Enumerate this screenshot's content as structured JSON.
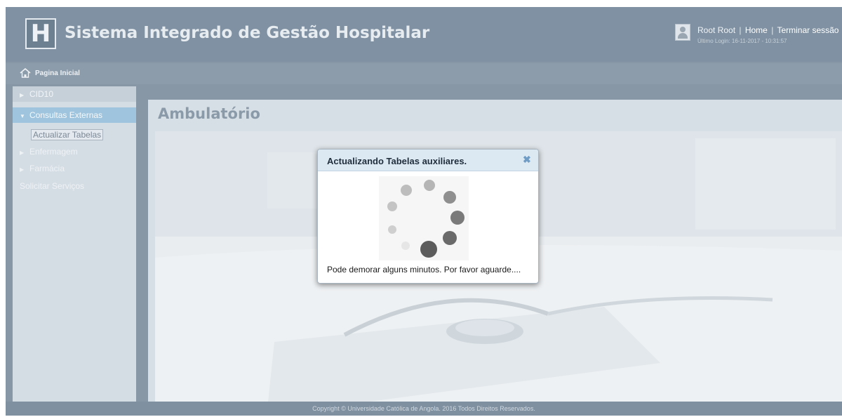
{
  "header": {
    "logo_letter": "H",
    "app_title": "Sistema Integrado de Gestão Hospitalar",
    "user_name": "Root Root",
    "home_link": "Home",
    "logout_link": "Terminar sessão",
    "separator": "|",
    "last_login": "Último Login: 16-11-2017 - 10:31:57"
  },
  "breadcrumb": {
    "label": "Pagina Inicial"
  },
  "sidebar": {
    "items": [
      {
        "label": "CID10"
      },
      {
        "label": "Consultas Externas"
      },
      {
        "label": "Actualizar Tabelas"
      },
      {
        "label": "Enfermagem"
      },
      {
        "label": "Farmácia"
      },
      {
        "label": "Solicitar Serviços"
      }
    ]
  },
  "main": {
    "title": "Ambulatório"
  },
  "modal": {
    "title": "Actualizando Tabelas auxiliares.",
    "close_glyph": "✖",
    "message": "Pode demorar alguns minutos. Por favor aguarde...."
  },
  "footer": {
    "copyright": "Copyright © Universidade Católica de Angola. 2016 Todos Direitos Reservados."
  },
  "colors": {
    "header_bg": "#7f91a2",
    "sidebar_active": "#9fc4dd",
    "modal_header": "#dce9f3",
    "close_icon": "#6f9cc4"
  },
  "icons": {
    "logo": "hospital-h-logo",
    "home": "home-icon",
    "avatar": "user-avatar-icon",
    "close": "close-icon",
    "spinner": "loading-spinner-icon"
  }
}
